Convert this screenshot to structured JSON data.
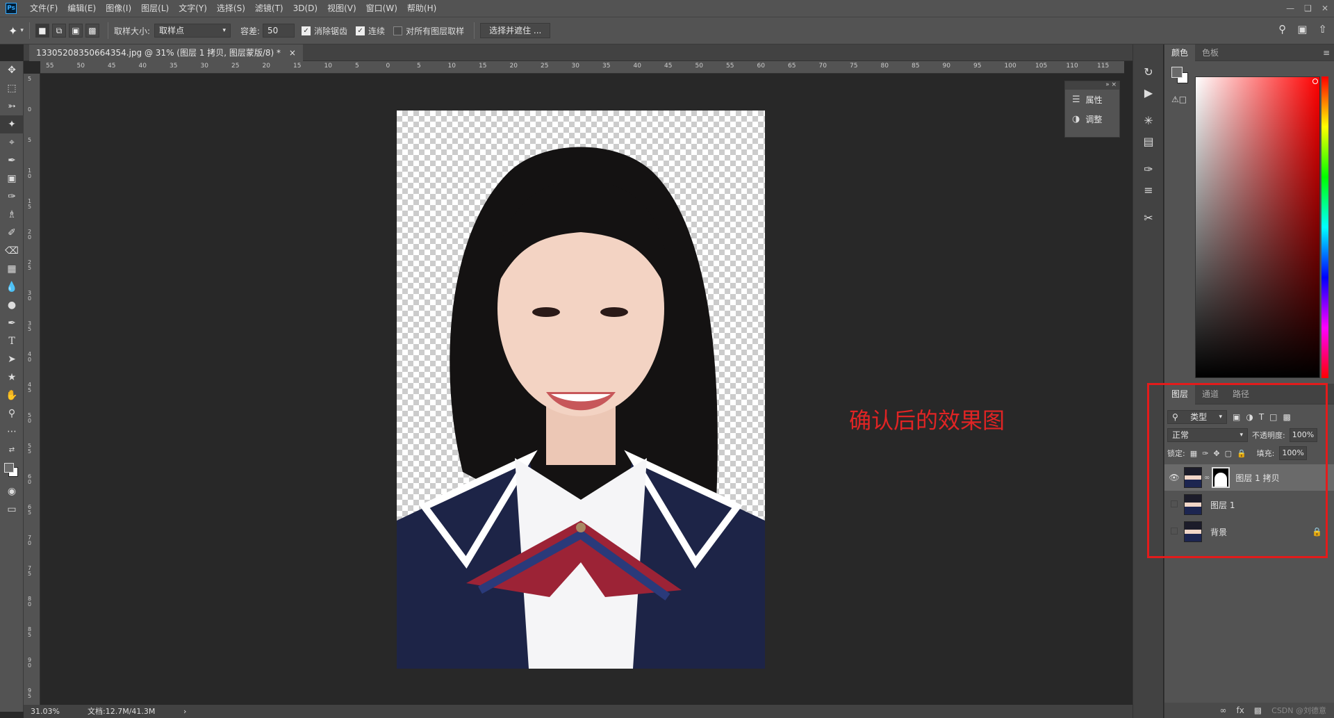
{
  "app": {
    "logo": "Ps"
  },
  "menu": [
    "文件(F)",
    "编辑(E)",
    "图像(I)",
    "图层(L)",
    "文字(Y)",
    "选择(S)",
    "滤镜(T)",
    "3D(D)",
    "视图(V)",
    "窗口(W)",
    "帮助(H)"
  ],
  "options": {
    "sample_size_label": "取样大小:",
    "sample_size_value": "取样点",
    "tolerance_label": "容差:",
    "tolerance_value": "50",
    "antialias_label": "消除锯齿",
    "antialias_checked": true,
    "contiguous_label": "连续",
    "contiguous_checked": true,
    "all_layers_label": "对所有图层取样",
    "all_layers_checked": false,
    "select_mask_button": "选择并遮住 ..."
  },
  "document": {
    "tab_title": "13305208350664354.jpg @ 31% (图层 1 拷贝, 图层蒙版/8) *",
    "zoom": "31.03%",
    "doc_size": "文档:12.7M/41.3M",
    "ruler_h": [
      "55",
      "50",
      "45",
      "40",
      "35",
      "30",
      "25",
      "20",
      "15",
      "10",
      "5",
      "0",
      "5",
      "10",
      "15",
      "20",
      "25",
      "30",
      "35",
      "40",
      "45",
      "50",
      "55",
      "60",
      "65",
      "70",
      "75",
      "80",
      "85",
      "90",
      "95",
      "100",
      "105",
      "110",
      "115"
    ],
    "ruler_v": [
      "5",
      "0",
      "5",
      "1 0",
      "1 5",
      "2 0",
      "2 5",
      "3 0",
      "3 5",
      "4 0",
      "4 5",
      "5 0",
      "5 5",
      "6 0",
      "6 5",
      "7 0",
      "7 5",
      "8 0",
      "8 5",
      "9 0",
      "9 5"
    ]
  },
  "annotation": "确认后的效果图",
  "float_panel": {
    "properties": "属性",
    "adjustments": "调整"
  },
  "color_panel": {
    "tabs": [
      "颜色",
      "色板"
    ]
  },
  "layers_panel": {
    "tabs": [
      "图层",
      "通道",
      "路径"
    ],
    "filter_label": "类型",
    "blend_mode": "正常",
    "opacity_label": "不透明度:",
    "opacity_value": "100%",
    "lock_label": "锁定:",
    "fill_label": "填充:",
    "fill_value": "100%",
    "layers": [
      {
        "name": "图层 1 拷贝",
        "visible": true,
        "selected": true
      },
      {
        "name": "图层 1",
        "visible": false,
        "selected": false
      },
      {
        "name": "背景",
        "visible": false,
        "selected": false
      }
    ],
    "footer": [
      "fx"
    ],
    "watermark": "CSDN @刘德意"
  }
}
